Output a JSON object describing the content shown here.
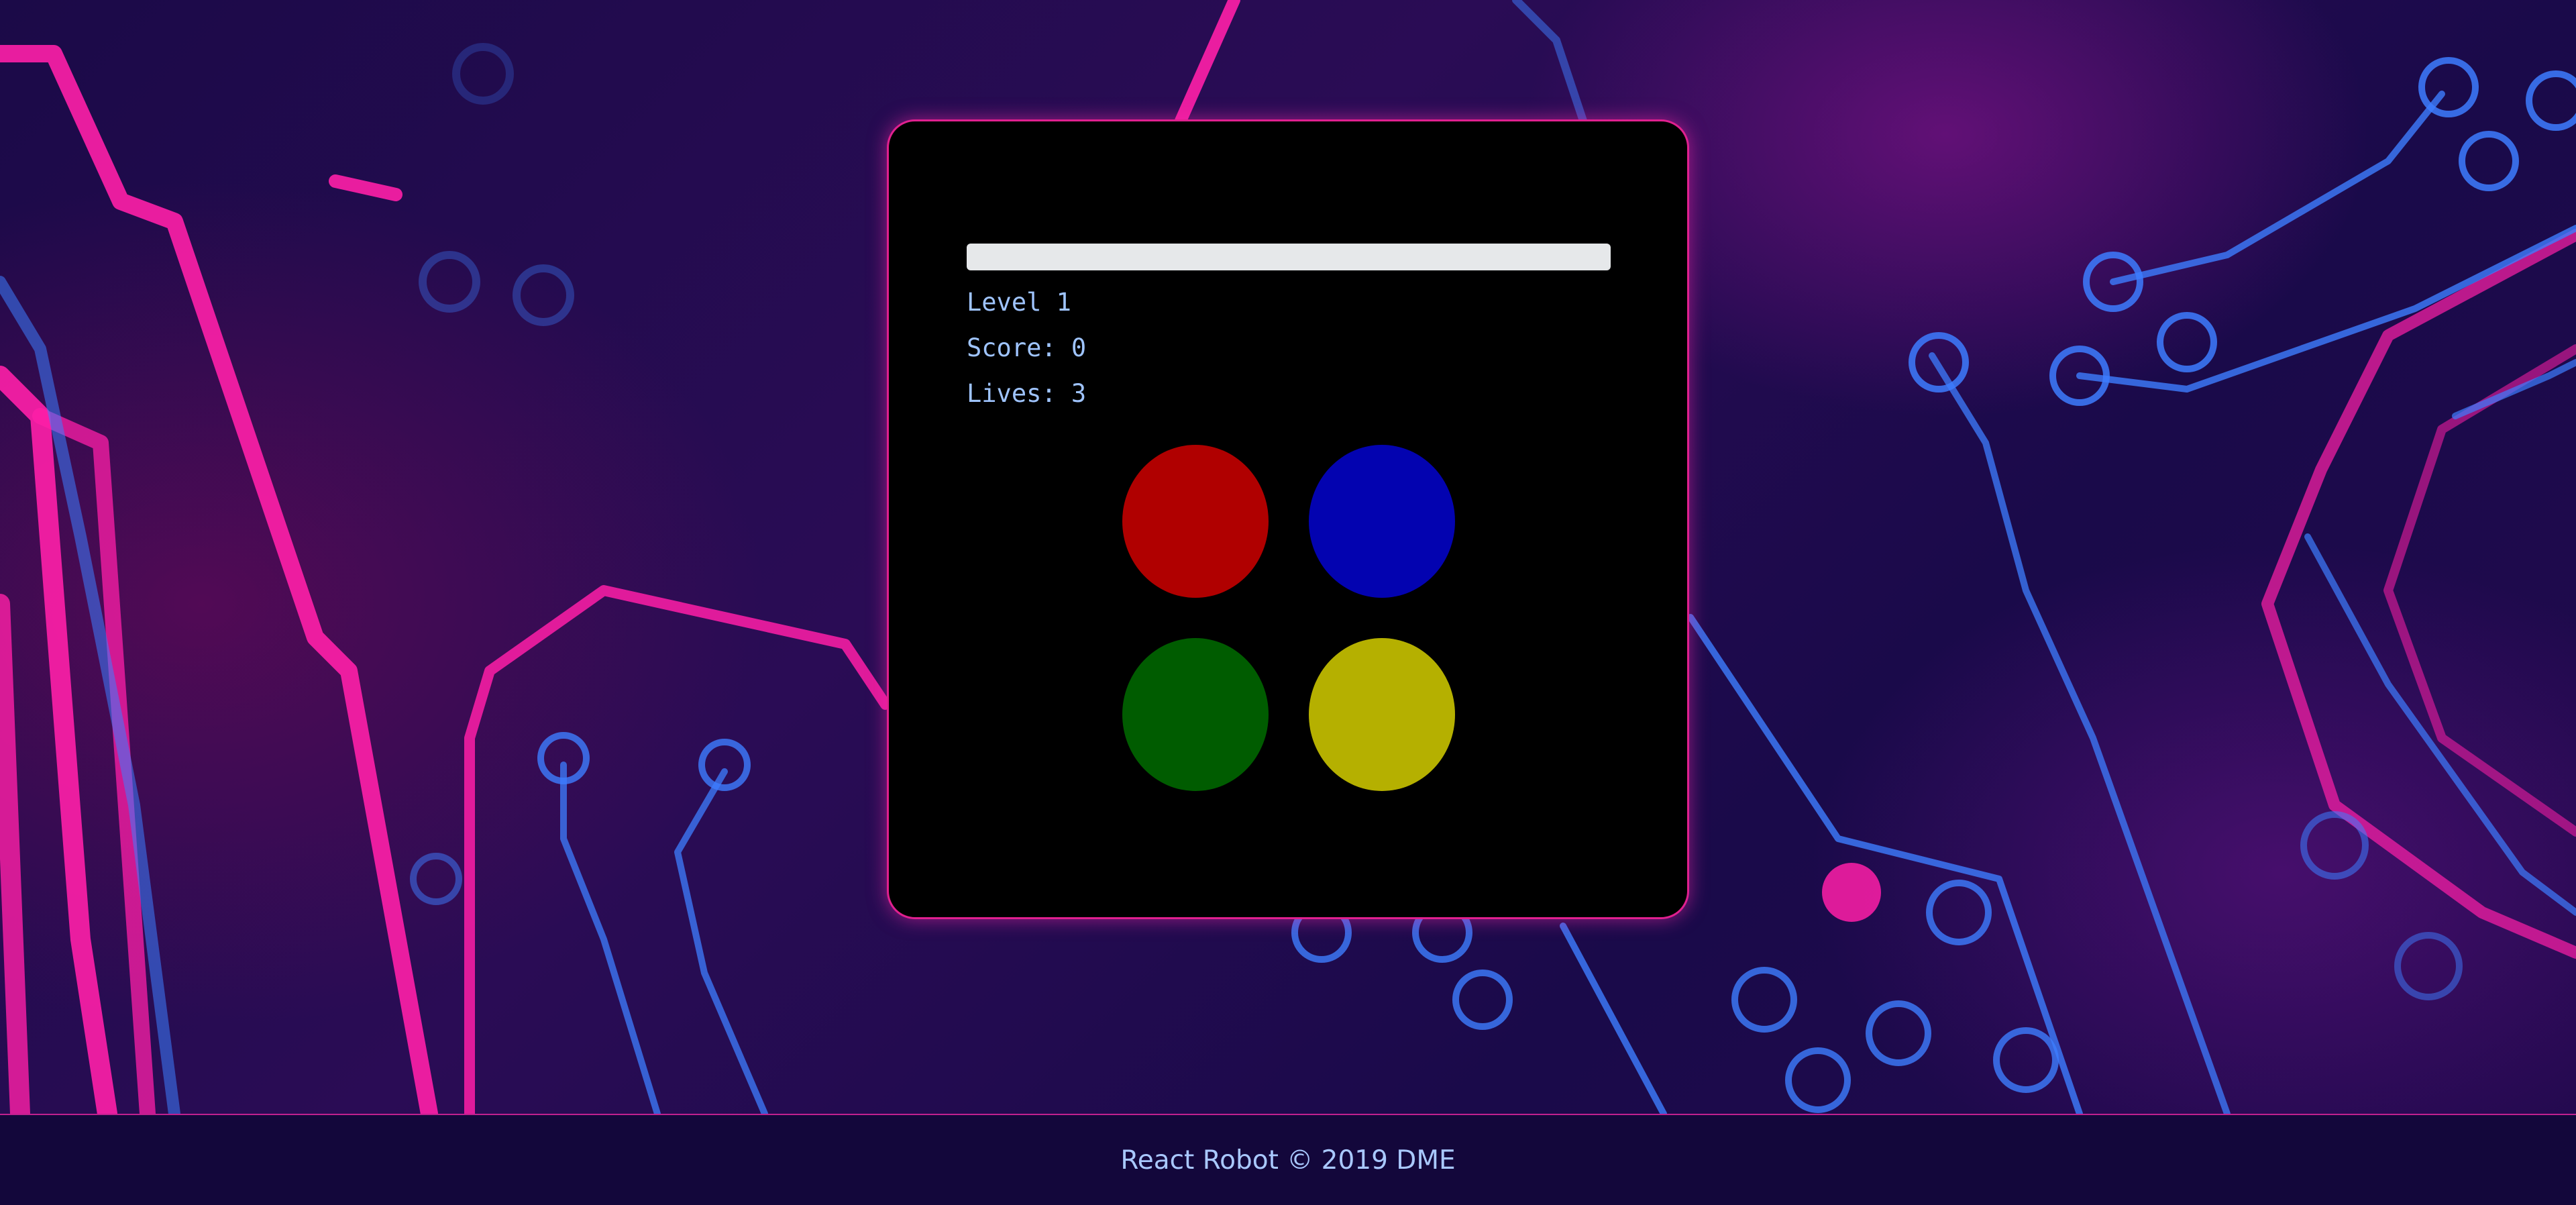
{
  "game": {
    "level_text": "Level 1",
    "score_text": "Score: 0",
    "lives_text": "Lives: 3",
    "progress": 0,
    "pads": [
      {
        "color_name": "red",
        "color": "#b00000"
      },
      {
        "color_name": "blue",
        "color": "#0303b0"
      },
      {
        "color_name": "green",
        "color": "#005c00"
      },
      {
        "color_name": "yellow",
        "color": "#b5b000"
      }
    ]
  },
  "footer": {
    "text": "React Robot © 2019 DME"
  },
  "colors": {
    "accent_pink": "#e0208f",
    "accent_blue": "#3d7dff",
    "stat_text": "#9fc4ff"
  }
}
